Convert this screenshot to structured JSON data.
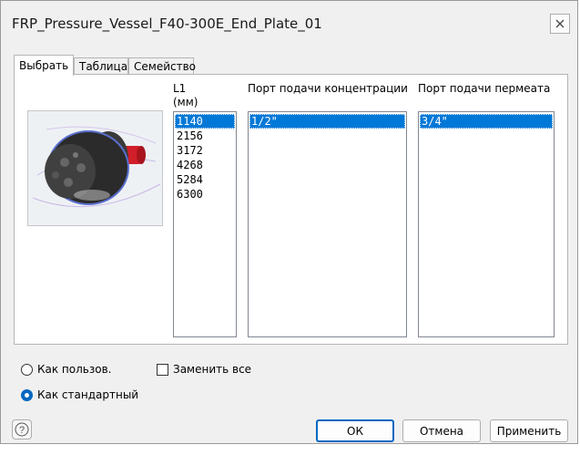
{
  "window": {
    "title": "FRP_Pressure_Vessel_F40-300E_End_Plate_01"
  },
  "tabs": [
    {
      "label": "Выбрать",
      "active": true
    },
    {
      "label": "Таблица",
      "active": false
    },
    {
      "label": "Семейство",
      "active": false
    }
  ],
  "columns": [
    {
      "header": "L1",
      "unit": "(мм)",
      "items": [
        "1140",
        "2156",
        "3172",
        "4268",
        "5284",
        "6300"
      ],
      "selected": 0
    },
    {
      "header": "Порт подачи концентрации",
      "items": [
        "1/2\""
      ],
      "selected": 0
    },
    {
      "header": "Порт подачи пермеата",
      "items": [
        "3/4\""
      ],
      "selected": 0
    }
  ],
  "options": {
    "as_custom": {
      "label": "Как пользов.",
      "checked": false
    },
    "as_standard": {
      "label": "Как стандартный",
      "checked": true
    },
    "replace_all": {
      "label": "Заменить все",
      "checked": false
    }
  },
  "buttons": {
    "help": "?",
    "ok": "ОК",
    "cancel": "Отмена",
    "apply": "Применить"
  },
  "colors": {
    "selection": "#0078d7",
    "accent": "#0067c0",
    "part_red": "#d11f2a",
    "part_dark": "#2b2b2b"
  }
}
